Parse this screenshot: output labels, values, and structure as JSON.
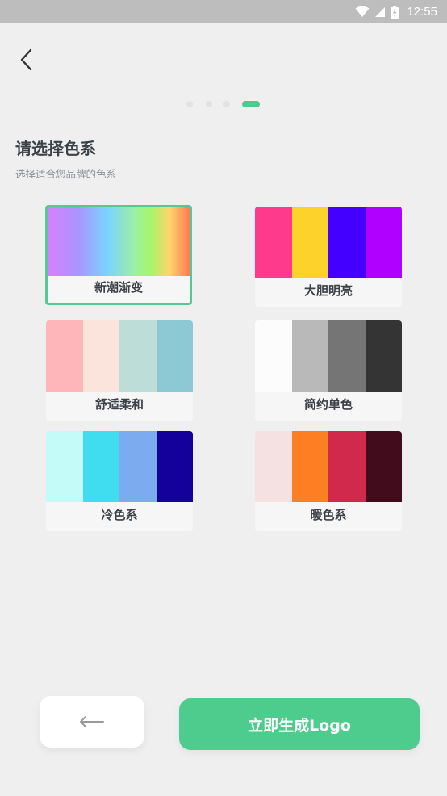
{
  "status_bar": {
    "time": "12:55"
  },
  "pager": {
    "total": 4,
    "active_index": 3
  },
  "header": {
    "title": "请选择色系",
    "subtitle": "选择适合您品牌的色系"
  },
  "palettes": [
    {
      "label": "新潮渐变",
      "selected": true,
      "colors": [
        "#d77eff",
        "#7ad3ff",
        "#a5f56b",
        "#ff7a54"
      ]
    },
    {
      "label": "大胆明亮",
      "selected": false,
      "colors": [
        "#fe3a8c",
        "#fdd22a",
        "#4400ff",
        "#b000ff"
      ]
    },
    {
      "label": "舒适柔和",
      "selected": false,
      "colors": [
        "#ffb6ba",
        "#fbe4dc",
        "#bcddd8",
        "#8dc8d5"
      ]
    },
    {
      "label": "简约单色",
      "selected": false,
      "colors": [
        "#fcfcfc",
        "#b9b9b9",
        "#757575",
        "#343434"
      ]
    },
    {
      "label": "冷色系",
      "selected": false,
      "colors": [
        "#c4fbf9",
        "#40ddf0",
        "#7dabf0",
        "#14009a"
      ]
    },
    {
      "label": "暖色系",
      "selected": false,
      "colors": [
        "#f5e1e2",
        "#fc7f24",
        "#d0294b",
        "#420c1d"
      ]
    }
  ],
  "actions": {
    "generate_label": "立即生成Logo"
  },
  "colors": {
    "accent": "#4dcc8e"
  }
}
